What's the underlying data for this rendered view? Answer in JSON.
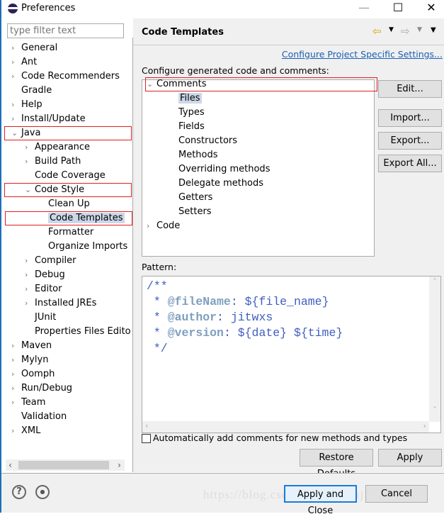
{
  "window": {
    "title": "Preferences"
  },
  "filter": {
    "placeholder": "type filter text"
  },
  "nav": [
    {
      "label": "General",
      "level": 0,
      "chev": "right"
    },
    {
      "label": "Ant",
      "level": 0,
      "chev": "right"
    },
    {
      "label": "Code Recommenders",
      "level": 0,
      "chev": "right"
    },
    {
      "label": "Gradle",
      "level": 0,
      "chev": ""
    },
    {
      "label": "Help",
      "level": 0,
      "chev": "right"
    },
    {
      "label": "Install/Update",
      "level": 0,
      "chev": "right"
    },
    {
      "label": "Java",
      "level": 0,
      "chev": "down",
      "highlight": true
    },
    {
      "label": "Appearance",
      "level": 1,
      "chev": "right"
    },
    {
      "label": "Build Path",
      "level": 1,
      "chev": "right"
    },
    {
      "label": "Code Coverage",
      "level": 1,
      "chev": ""
    },
    {
      "label": "Code Style",
      "level": 1,
      "chev": "down",
      "highlight": true
    },
    {
      "label": "Clean Up",
      "level": 2,
      "chev": ""
    },
    {
      "label": "Code Templates",
      "level": 2,
      "chev": "",
      "highlight": true,
      "selected": true
    },
    {
      "label": "Formatter",
      "level": 2,
      "chev": ""
    },
    {
      "label": "Organize Imports",
      "level": 2,
      "chev": ""
    },
    {
      "label": "Compiler",
      "level": 1,
      "chev": "right"
    },
    {
      "label": "Debug",
      "level": 1,
      "chev": "right"
    },
    {
      "label": "Editor",
      "level": 1,
      "chev": "right"
    },
    {
      "label": "Installed JREs",
      "level": 1,
      "chev": "right"
    },
    {
      "label": "JUnit",
      "level": 1,
      "chev": ""
    },
    {
      "label": "Properties Files Edito",
      "level": 1,
      "chev": ""
    },
    {
      "label": "Maven",
      "level": 0,
      "chev": "right"
    },
    {
      "label": "Mylyn",
      "level": 0,
      "chev": "right"
    },
    {
      "label": "Oomph",
      "level": 0,
      "chev": "right"
    },
    {
      "label": "Run/Debug",
      "level": 0,
      "chev": "right"
    },
    {
      "label": "Team",
      "level": 0,
      "chev": "right"
    },
    {
      "label": "Validation",
      "level": 0,
      "chev": ""
    },
    {
      "label": "XML",
      "level": 0,
      "chev": "right"
    }
  ],
  "page": {
    "title": "Code Templates",
    "link": "Configure Project Specific Settings...",
    "configure_label": "Configure generated code and comments:",
    "pattern_label": "Pattern:",
    "auto_comments": "Automatically add comments for new methods and types",
    "auto_comments_checked": false
  },
  "templates": [
    {
      "label": "Comments",
      "level": 0,
      "chev": "down",
      "highlight": true
    },
    {
      "label": "Files",
      "level": 1,
      "selected": true
    },
    {
      "label": "Types",
      "level": 1
    },
    {
      "label": "Fields",
      "level": 1
    },
    {
      "label": "Constructors",
      "level": 1
    },
    {
      "label": "Methods",
      "level": 1
    },
    {
      "label": "Overriding methods",
      "level": 1
    },
    {
      "label": "Delegate methods",
      "level": 1
    },
    {
      "label": "Getters",
      "level": 1
    },
    {
      "label": "Setters",
      "level": 1
    },
    {
      "label": "Code",
      "level": 0,
      "chev": "right"
    }
  ],
  "buttons": {
    "edit": "Edit...",
    "import": "Import...",
    "export": "Export...",
    "export_all": "Export All...",
    "restore": "Restore Defaults",
    "apply": "Apply",
    "apply_close": "Apply and Close",
    "cancel": "Cancel"
  },
  "pattern": {
    "l1": "/**",
    "l2_pre": " * ",
    "l2_tag": "@fileName",
    "l2_rest": ": ${file_name}",
    "l3_pre": " * ",
    "l3_tag": "@author",
    "l3_rest": ": jitwxs",
    "l4_pre": " * ",
    "l4_tag": "@version",
    "l4_rest": ": ${date} ${time}",
    "l5": " */"
  },
  "watermark": "https://blog.csdn.net/yuanlaijike"
}
